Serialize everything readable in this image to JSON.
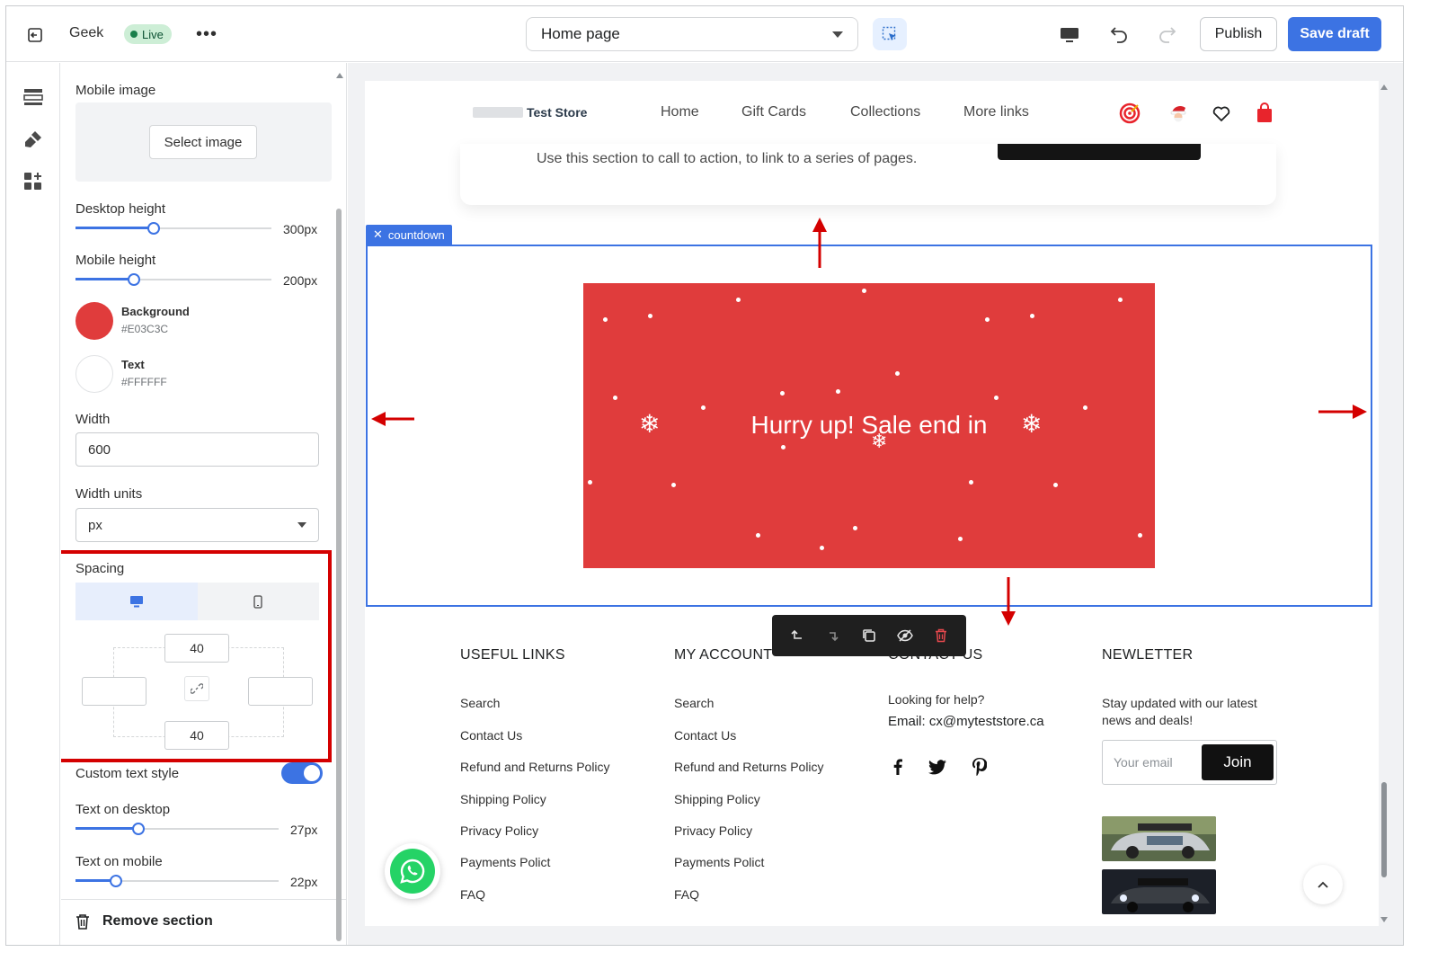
{
  "topbar": {
    "store_name": "Geek",
    "status_badge": "Live",
    "more_label": "•••",
    "page_selector": "Home page",
    "publish_label": "Publish",
    "save_label": "Save draft",
    "icons": [
      "exit-icon",
      "more-icon",
      "select-element-icon",
      "desktop-icon",
      "undo-icon",
      "redo-icon"
    ]
  },
  "rail": {
    "icons": [
      "sections-icon",
      "theme-style-icon",
      "apps-icon"
    ]
  },
  "panel": {
    "mobile_image_label": "Mobile image",
    "select_image_label": "Select image",
    "desktop_height_label": "Desktop height",
    "desktop_height_value": "300px",
    "desktop_height_fraction": 0.4,
    "mobile_height_label": "Mobile height",
    "mobile_height_value": "200px",
    "mobile_height_fraction": 0.3,
    "background_label": "Background",
    "background_hex": "#E03C3C",
    "text_label": "Text",
    "text_hex": "#FFFFFF",
    "width_label": "Width",
    "width_value": "600",
    "width_units_label": "Width units",
    "width_units_value": "px",
    "spacing_label": "Spacing",
    "spacing_top": "40",
    "spacing_bottom": "40",
    "spacing_left": "",
    "spacing_right": "",
    "custom_text_style_label": "Custom text style",
    "custom_text_style_on": true,
    "text_desktop_label": "Text on desktop",
    "text_desktop_value": "27px",
    "text_desktop_fraction": 0.31,
    "text_mobile_label": "Text on mobile",
    "text_mobile_value": "22px",
    "text_mobile_fraction": 0.2,
    "remove_label": "Remove section"
  },
  "preview": {
    "store_logo": "Test Store",
    "nav_links": [
      "Home",
      "Gift Cards",
      "Collections",
      "More links"
    ],
    "nav_icons": [
      "target-icon",
      "santa-icon",
      "heart-icon",
      "shopping-bag-icon"
    ],
    "cta_text": "Use this section to call to action, to link to a series of pages.",
    "section_tag": "countdown",
    "countdown_text": "Hurry up! Sale end in",
    "footer": {
      "useful_links_title": "USEFUL LINKS",
      "useful_links": [
        "Search",
        "Contact Us",
        "Refund and Returns Policy",
        "Shipping Policy",
        "Privacy Policy",
        "Payments Polict",
        "FAQ"
      ],
      "my_account_title": "MY ACCOUNT",
      "my_account_links": [
        "Search",
        "Contact Us",
        "Refund and Returns Policy",
        "Shipping Policy",
        "Privacy Policy",
        "Payments Polict",
        "FAQ"
      ],
      "contact_title": "CONTACT US",
      "contact_help": "Looking for help?",
      "contact_email": "Email:  cx@myteststore.ca",
      "social_icons": [
        "facebook-icon",
        "twitter-icon",
        "pinterest-icon"
      ],
      "newsletter_title": "NEWLETTER",
      "newsletter_text": "Stay updated with our latest news and deals!",
      "email_placeholder": "Your email",
      "join_label": "Join"
    }
  },
  "colors": {
    "accent": "#3C73E3",
    "countdown_bg": "#E03C3C",
    "highlight_red": "#D40000",
    "live_green": "#CDEED6"
  }
}
